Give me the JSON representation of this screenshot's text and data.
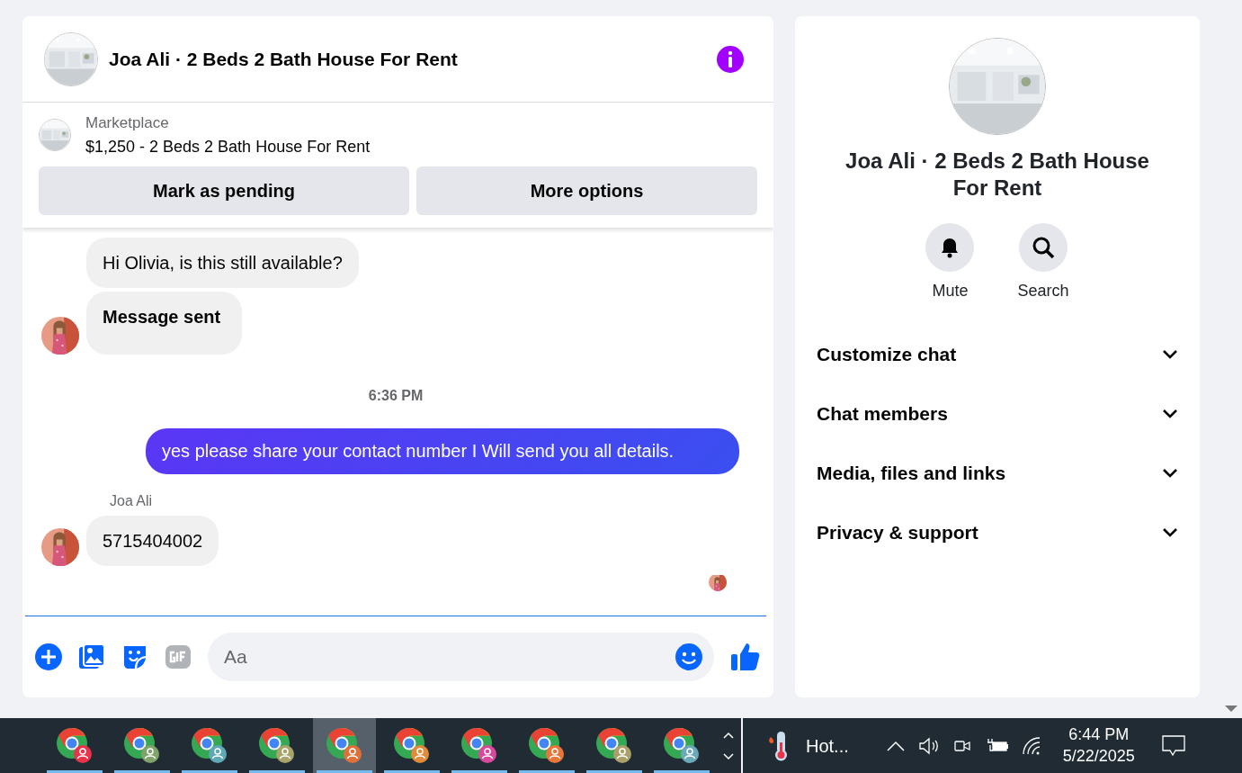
{
  "chat": {
    "title": "Joa Ali · 2 Beds 2 Bath House For Rent",
    "listing": {
      "source": "Marketplace",
      "summary": "$1,250 - 2 Beds 2 Bath House For Rent"
    },
    "listing_buttons": [
      "Mark as pending",
      "More options"
    ],
    "messages": [
      {
        "kind": "incoming",
        "text": "Hi Olivia, is this still available?",
        "bold": false,
        "avatar": false
      },
      {
        "kind": "incoming",
        "text": "Message sent",
        "bold": true,
        "avatar": true
      },
      {
        "kind": "timestamp",
        "text": "6:36 PM"
      },
      {
        "kind": "outgoing",
        "text": "yes please share your contact number I Will send you all details."
      },
      {
        "kind": "sender",
        "text": "Joa Ali"
      },
      {
        "kind": "incoming",
        "text": "5715404002",
        "bold": false,
        "avatar": true
      },
      {
        "kind": "seen"
      }
    ],
    "composer": {
      "placeholder": "Aa"
    }
  },
  "details": {
    "title": "Joa Ali · 2 Beds 2 Bath House For Rent",
    "actions": [
      {
        "kind": "mute",
        "label": "Mute"
      },
      {
        "kind": "search",
        "label": "Search"
      }
    ],
    "sections": [
      {
        "label": "Customize chat",
        "expanded": false
      },
      {
        "label": "Chat members",
        "expanded": false
      },
      {
        "label": "Media, files and links",
        "expanded": false
      },
      {
        "label": "Privacy & support",
        "expanded": false
      }
    ]
  },
  "taskbar": {
    "apps": [
      {
        "color": "#e8334a",
        "selected": false
      },
      {
        "color": "#7fa36b",
        "selected": false
      },
      {
        "color": "#5fa8b5",
        "selected": false
      },
      {
        "color": "#a9a56a",
        "selected": false
      },
      {
        "color": "#e0703a",
        "selected": true
      },
      {
        "color": "#e08a3a",
        "selected": false
      },
      {
        "color": "#d9499b",
        "selected": false
      },
      {
        "color": "#e8763a",
        "selected": false
      },
      {
        "color": "#a9a06a",
        "selected": false
      },
      {
        "color": "#6aaab8",
        "selected": false
      }
    ],
    "weather": "Hot...",
    "time": "6:44 PM",
    "date": "5/22/2025"
  }
}
